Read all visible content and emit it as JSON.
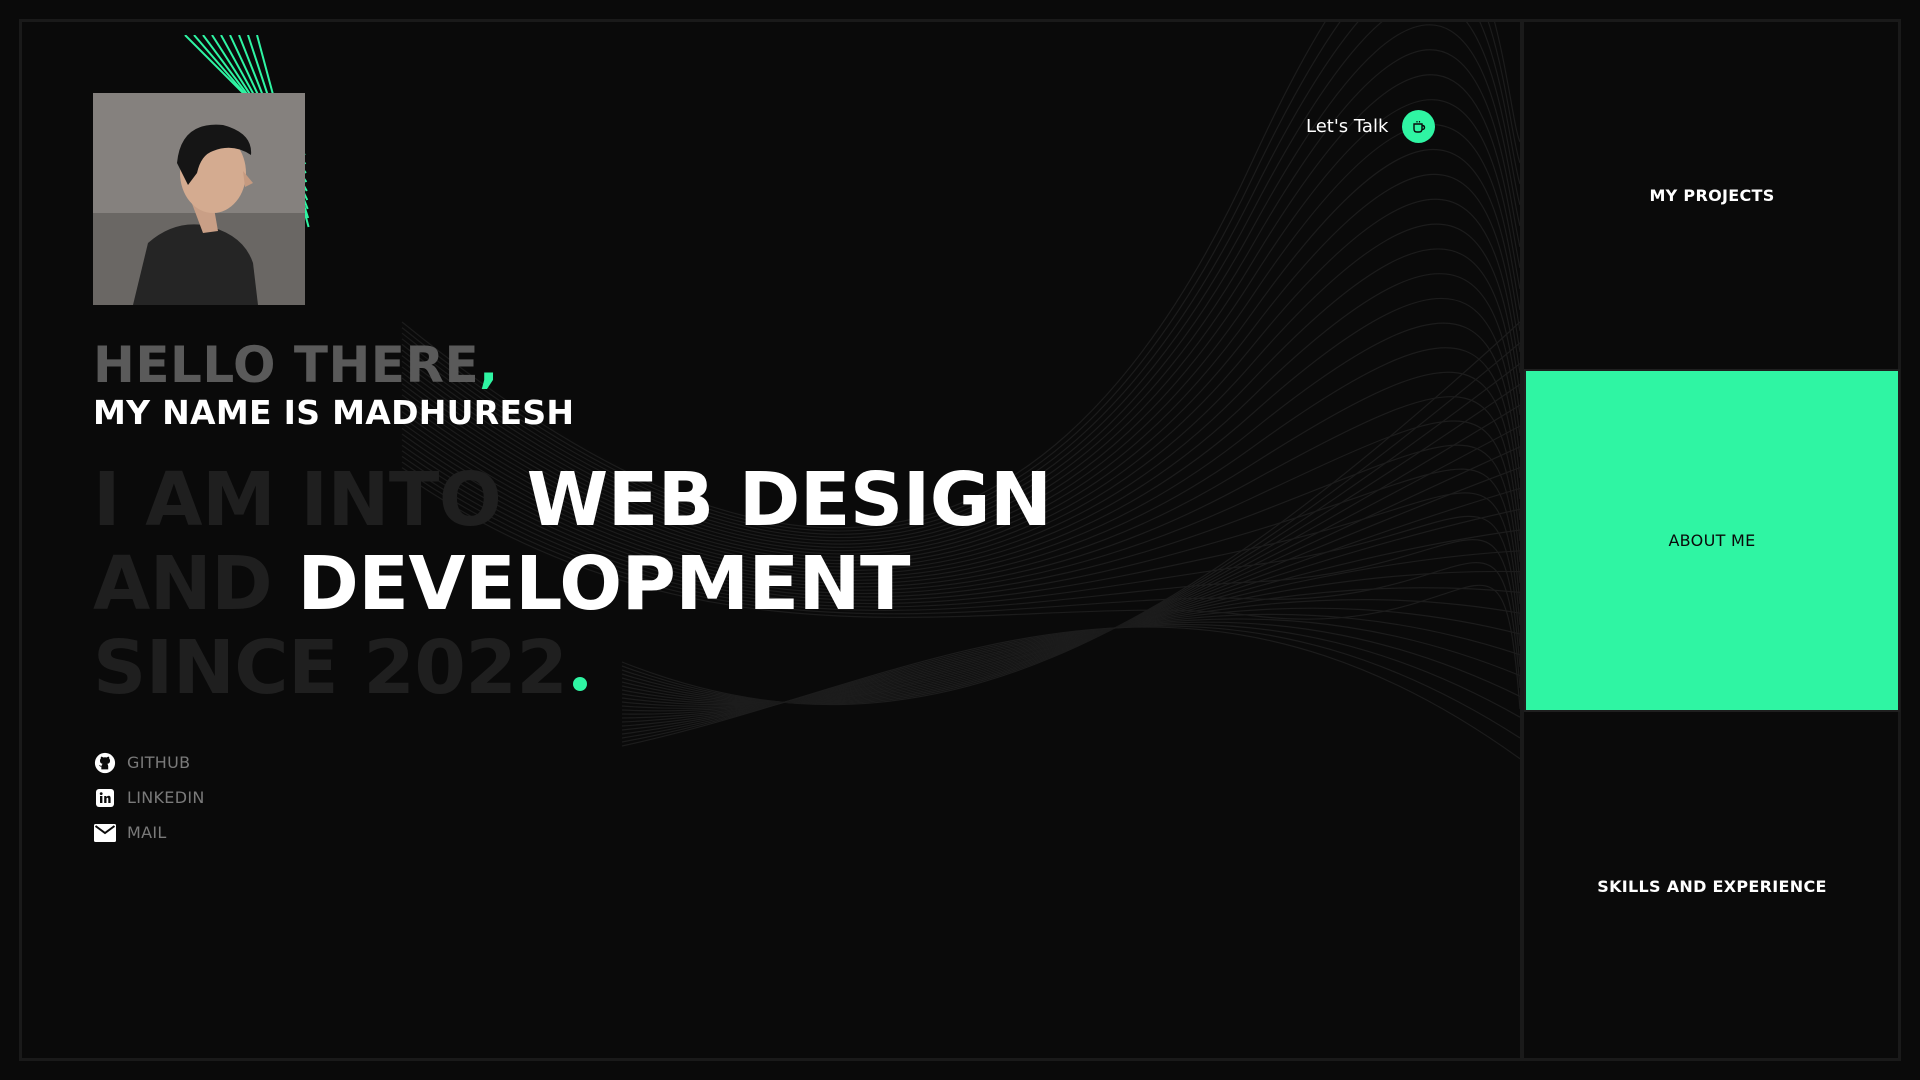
{
  "hero": {
    "hello": "HELLO THERE",
    "hello_comma": ",",
    "name": "MY NAME IS MADHURESH",
    "line1_dim": "I AM INTO",
    "line1_bright": "WEB DESIGN",
    "line2_dim": "AND",
    "line2_bright": "DEVELOPMENT",
    "line3_dim": "SINCE 2022"
  },
  "social": [
    {
      "label": "GITHUB",
      "icon": "github-icon"
    },
    {
      "label": "LINKEDIN",
      "icon": "linkedin-icon"
    },
    {
      "label": "MAIL",
      "icon": "mail-icon"
    }
  ],
  "cta": {
    "label": "Let's Talk",
    "icon": "coffee-icon"
  },
  "nav": [
    {
      "label": "MY PROJECTS",
      "active": false
    },
    {
      "label": "ABOUT ME",
      "active": true
    },
    {
      "label": "SKILLS AND EXPERIENCE",
      "active": false
    }
  ],
  "colors": {
    "accent": "#2ff5a3",
    "background": "#0a0a0a",
    "dim_text": "#1f1f1f",
    "muted_text": "#5a5a5a"
  }
}
